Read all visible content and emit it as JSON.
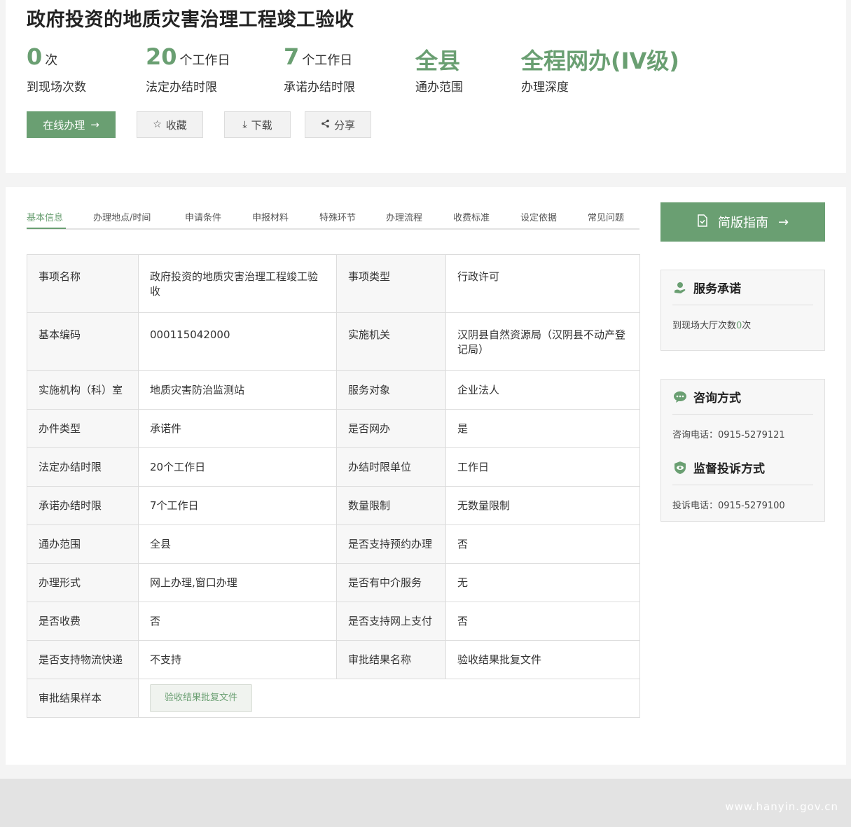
{
  "header": {
    "title": "政府投资的地质灾害治理工程竣工验收",
    "stats": [
      {
        "value": "0",
        "unit": "次",
        "label": "到现场次数"
      },
      {
        "value": "20",
        "unit": "个工作日",
        "label": "法定办结时限"
      },
      {
        "value": "7",
        "unit": "个工作日",
        "label": "承诺办结时限"
      },
      {
        "value": "全县",
        "unit": "",
        "label": "通办范围"
      },
      {
        "value": "全程网办(IV级)",
        "unit": "",
        "label": "办理深度"
      }
    ],
    "buttons": {
      "online": "在线办理",
      "favorite": "收藏",
      "download": "下载",
      "share": "分享"
    }
  },
  "tabs": [
    "基本信息",
    "办理地点/时间",
    "申请条件",
    "申报材料",
    "特殊环节",
    "办理流程",
    "收费标准",
    "设定依据",
    "常见问题"
  ],
  "table": {
    "rows": [
      [
        "事项名称",
        "政府投资的地质灾害治理工程竣工验收",
        "事项类型",
        "行政许可"
      ],
      [
        "基本编码",
        "000115042000",
        "实施机关",
        "汉阴县自然资源局（汉阴县不动产登记局）"
      ],
      [
        "实施机构（科）室",
        "地质灾害防治监测站",
        "服务对象",
        "企业法人"
      ],
      [
        "办件类型",
        "承诺件",
        "是否网办",
        "是"
      ],
      [
        "法定办结时限",
        "20个工作日",
        "办结时限单位",
        "工作日"
      ],
      [
        "承诺办结时限",
        "7个工作日",
        "数量限制",
        "无数量限制"
      ],
      [
        "通办范围",
        "全县",
        "是否支持预约办理",
        "否"
      ],
      [
        "办理形式",
        "网上办理,窗口办理",
        "是否有中介服务",
        "无"
      ],
      [
        "是否收费",
        "否",
        "是否支持网上支付",
        "否"
      ],
      [
        "是否支持物流快递",
        "不支持",
        "审批结果名称",
        "验收结果批复文件"
      ]
    ],
    "last_row": {
      "label": "审批结果样本",
      "button": "验收结果批复文件"
    }
  },
  "sidebar": {
    "guide_button": "简版指南",
    "service": {
      "title": "服务承诺",
      "text_prefix": "到现场大厅次数",
      "count": "0",
      "text_suffix": "次"
    },
    "consult": {
      "title": "咨询方式",
      "text": "咨询电话：0915-5279121"
    },
    "complaint": {
      "title": "监督投诉方式",
      "text": "投诉电话：0915-5279100"
    }
  },
  "footer": {
    "url": "www.hanyin.gov.cn"
  },
  "colors": {
    "accent": "#6a9f72",
    "text": "#333333"
  },
  "icons": {
    "arrow": "arrow-right-icon",
    "star": "star-icon",
    "download": "download-icon",
    "share": "share-icon",
    "doc": "document-icon",
    "hand": "hand-heart-icon",
    "chat": "chat-bubble-icon",
    "eye": "eye-shield-icon"
  }
}
